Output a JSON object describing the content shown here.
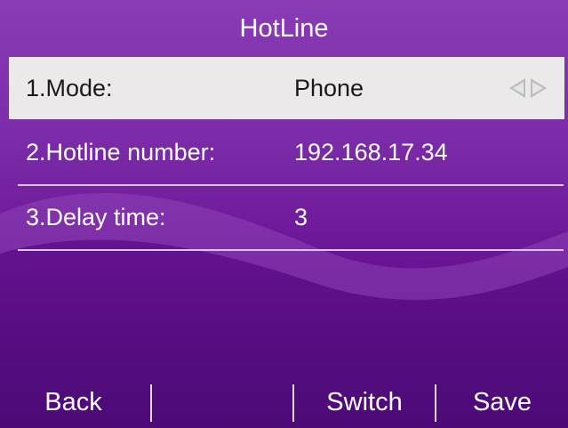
{
  "screen": {
    "title": "HotLine"
  },
  "menu": {
    "items": [
      {
        "label": "1.Mode:",
        "value": "Phone",
        "selected": true
      },
      {
        "label": "2.Hotline number:",
        "value": "192.168.17.34",
        "selected": false
      },
      {
        "label": "3.Delay time:",
        "value": "3",
        "selected": false
      }
    ]
  },
  "softkeys": {
    "back": "Back",
    "empty": "",
    "switch": "Switch",
    "save": "Save"
  },
  "colors": {
    "background_top": "#8a3bb6",
    "background_bottom": "#4d0a78",
    "selected_row": "#ece9ea",
    "text": "#ffffff",
    "selected_text": "#1a1a1a"
  },
  "icons": {
    "mode_switch": "left-right-arrows-icon"
  }
}
